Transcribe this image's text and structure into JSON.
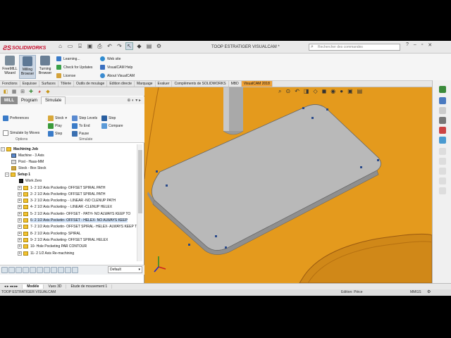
{
  "app": {
    "logo_text": "SOLIDWORKS",
    "title": "TOOP ESTRATIGER VISUALCAM *"
  },
  "search": {
    "placeholder": "Rechercher des commandes"
  },
  "ribbon": {
    "big_buttons": [
      "FreeMILL Wizard",
      "Milling Browser",
      "Turning Browser"
    ],
    "links": [
      "Learning...",
      "Check for Updates",
      "License",
      "Web site",
      "VisualCAM Help",
      "About VisualCAM"
    ]
  },
  "command_tabs": [
    "Fonctions",
    "Esquisse",
    "Surfaces",
    "Tôlerie",
    "Outils de moulage",
    "Edition directe",
    "Marquage",
    "Evaluer",
    "Compléments de SOLIDWORKS",
    "MBD",
    "VisualCAM 2018"
  ],
  "visualcam": {
    "tabs": [
      "MILL",
      "Program",
      "Simulate"
    ],
    "preferences": "Preferences",
    "simulate_by_moves": "Simulate by Moves",
    "options_label": "Options",
    "simulate_label": "Simulate",
    "stock": "Stock",
    "play": "Play",
    "step": "Step",
    "step_levels": "Step Levels",
    "to_end": "To End",
    "pause": "Pause",
    "stop": "Stop",
    "compare": "Compare"
  },
  "tree": {
    "root": "Machining Job",
    "machine": "Machine - 3 Axis",
    "post": "Post - Haas-MM",
    "stock": "Stock - Box Stock",
    "setup": "Setup 1",
    "work_zero": "Work Zero",
    "ops": [
      "1- 2 1/2 Axis Pocketing- OFFSET SPIRAL PATH",
      "2- 2 1/2 Axis Pocketing- OFFSET SPIRAL PATH",
      "3- 2 1/2 Axis Pocketing- - LINEAR -NO CLENUP PATH",
      "4- 2 1/2 Axis Pocketing- - LINEAR -CLENUP HELEX",
      "5- 2 1/2 Axis Pocketin- OFFSET - PATH- NO  ALWAYS KEEP TO",
      "6- 2 1/2 Axis Pocketin- OFFSET - HELEX- NO  ALWAYS KEEP",
      "7- 2 1/2 Axis Pocketin- OFFSET SPIRAL- HELEX- ALWAYS KEEP TOO",
      "8- 2 1/2 Axis Pocketing- SPIRAL",
      "9- 2 1/2 Axis Pocketing- OFFSET SPIRAL HELEX",
      "10- Hole Pocketing PAR CONTOUR",
      "11- 2 1/2 Axis Re-machining"
    ]
  },
  "dropdown": {
    "value": "Default"
  },
  "sheet_tabs": [
    "Modèle",
    "Vues 3D",
    "Etude de mouvement 1"
  ],
  "status": {
    "left": "TOOP ESTRATIGER VISUALCAM",
    "mode": "Edition: Pièce",
    "units": "MMGS"
  },
  "colors": {
    "viewport": "#e49a1d",
    "part": "#b9b9b9",
    "active_tab": "#f0a33a"
  }
}
